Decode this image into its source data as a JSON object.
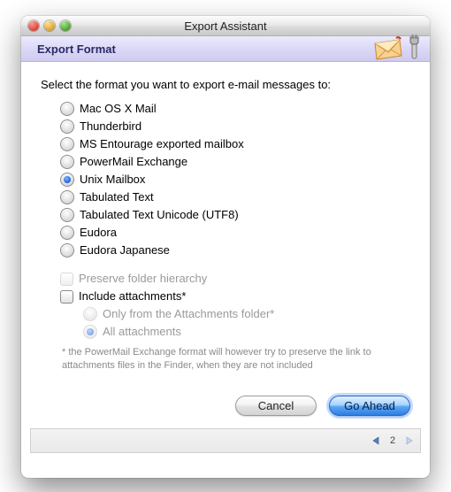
{
  "window": {
    "title": "Export Assistant"
  },
  "header": {
    "title": "Export Format"
  },
  "prompt": "Select the format you want to export e-mail messages to:",
  "formats": [
    {
      "label": "Mac OS X Mail",
      "selected": false
    },
    {
      "label": "Thunderbird",
      "selected": false
    },
    {
      "label": "MS Entourage exported mailbox",
      "selected": false
    },
    {
      "label": "PowerMail Exchange",
      "selected": false
    },
    {
      "label": "Unix Mailbox",
      "selected": true
    },
    {
      "label": "Tabulated Text",
      "selected": false
    },
    {
      "label": "Tabulated Text Unicode (UTF8)",
      "selected": false
    },
    {
      "label": "Eudora",
      "selected": false
    },
    {
      "label": "Eudora Japanese",
      "selected": false
    }
  ],
  "options": {
    "preserve_hierarchy": {
      "label": "Preserve folder hierarchy",
      "enabled": false,
      "checked": false
    },
    "include_attachments": {
      "label": "Include attachments*",
      "enabled": true,
      "checked": false
    },
    "only_from_folder": {
      "label": "Only from the Attachments folder*",
      "enabled": false,
      "selected": false
    },
    "all_attachments": {
      "label": "All attachments",
      "enabled": false,
      "selected": true
    }
  },
  "footnote": "* the PowerMail Exchange format will however try to preserve the link to attachments files in the Finder, when they are not included",
  "buttons": {
    "cancel": "Cancel",
    "go_ahead": "Go Ahead"
  },
  "pager": {
    "page": "2"
  }
}
